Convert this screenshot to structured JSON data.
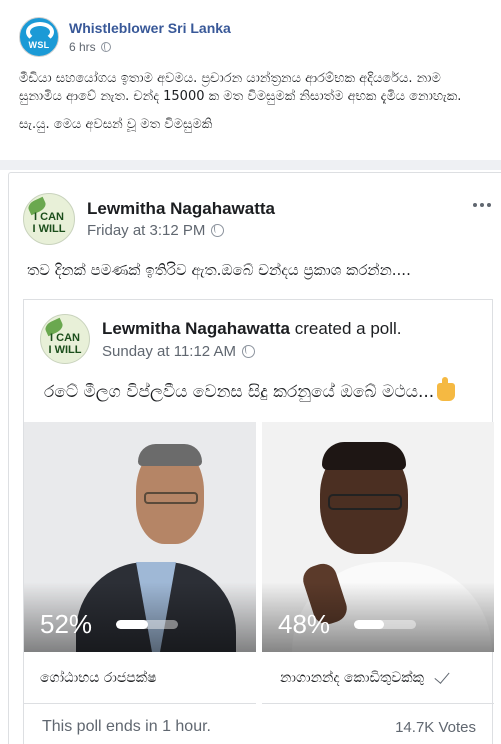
{
  "outer_post": {
    "page_name": "Whistleblower Sri Lanka",
    "avatar_text": "WSL",
    "time": "6 hrs",
    "text_lines": [
      "මීඩියා සහයෝගය ඉතාම අවමය. ප්‍රචාරන යාන්ත්‍රනය ආරම්භක අදියරේය. නාම සුනාමිය ආවේ නැත. චන්ද 15000 ක මත විමසුමක් නිසාත්ම අභක දැමිය නොහැක.",
      "සැ.යු. මෙය අවසන් වූ මත විමසුමකි"
    ]
  },
  "shared_post": {
    "author": "Lewmitha Nagahawatta",
    "avatar_line1": "I CAN",
    "avatar_line2": "I WILL",
    "time": "Friday at 3:12 PM",
    "text": "තව දිනක් පමණක් ඉතිරිව ඇත.ඔබේ චන්දය ප්‍රකාශ කරන්න...."
  },
  "poll": {
    "author": "Lewmitha Nagahawatta",
    "action": "created a poll.",
    "time": "Sunday at 11:12 AM",
    "question": "රටේ මීලග විප්ලවීය වෙනස සිදු කරනුයේ ඔබේ මථය...",
    "options": [
      {
        "label": "ගෝඨාභය රාජපක්ෂ",
        "percent_text": "52%",
        "percent": 52,
        "selected": false
      },
      {
        "label": "නාගානන්ද කොඩිතුවක්කු",
        "percent_text": "48%",
        "percent": 48,
        "selected": true
      }
    ],
    "ends_text": "This poll ends in 1 hour.",
    "votes_text": "14.7K Votes"
  }
}
